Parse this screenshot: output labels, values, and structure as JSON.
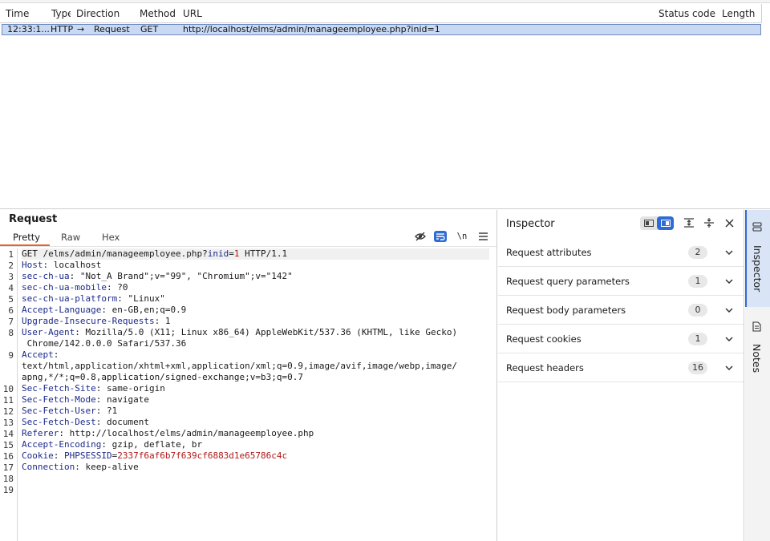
{
  "table": {
    "columns": [
      "Time",
      "Type",
      "Direction",
      "Method",
      "URL",
      "Status code",
      "Length"
    ],
    "row": {
      "time": "12:33:1...",
      "type": "HTTP",
      "direction_arrow": "→",
      "direction": "Request",
      "method": "GET",
      "url": "http://localhost/elms/admin/manageemployee.php?inid=1",
      "status": "",
      "length": ""
    }
  },
  "request": {
    "title": "Request",
    "tabs": [
      "Pretty",
      "Raw",
      "Hex"
    ],
    "active_tab": "Pretty",
    "toolbar_newline": "\\n",
    "line_numbers": [
      "1",
      "2",
      "3",
      "4",
      "5",
      "6",
      "7",
      "8",
      "9",
      "10",
      "11",
      "12",
      "13",
      "14",
      "15",
      "16",
      "17",
      "18",
      "19"
    ],
    "lines": {
      "l1": {
        "method": "GET",
        "path": " /elms/admin/manageemployee.php?",
        "param": "inid",
        "eq": "=",
        "val": "1",
        "proto": " HTTP/1.1"
      },
      "l2": {
        "k": "Host",
        "v": "localhost"
      },
      "l3": {
        "k": "sec-ch-ua",
        "v": "\"Not_A Brand\";v=\"99\", \"Chromium\";v=\"142\""
      },
      "l4": {
        "k": "sec-ch-ua-mobile",
        "v": "?0"
      },
      "l5": {
        "k": "sec-ch-ua-platform",
        "v": "\"Linux\""
      },
      "l6": {
        "k": "Accept-Language",
        "v": "en-GB,en;q=0.9"
      },
      "l7": {
        "k": "Upgrade-Insecure-Requests",
        "v": "1"
      },
      "l8": {
        "k": "User-Agent",
        "v": "Mozilla/5.0 (X11; Linux x86_64) AppleWebKit/537.36 (KHTML, like Gecko)",
        "v2": " Chrome/142.0.0.0 Safari/537.36"
      },
      "l9": {
        "k": "Accept",
        "v": "text/html,application/xhtml+xml,application/xml;q=0.9,image/avif,image/webp,image/",
        "v2": "apng,*/*;q=0.8,application/signed-exchange;v=b3;q=0.7"
      },
      "l10": {
        "k": "Sec-Fetch-Site",
        "v": "same-origin"
      },
      "l11": {
        "k": "Sec-Fetch-Mode",
        "v": "navigate"
      },
      "l12": {
        "k": "Sec-Fetch-User",
        "v": "?1"
      },
      "l13": {
        "k": "Sec-Fetch-Dest",
        "v": "document"
      },
      "l14": {
        "k": "Referer",
        "v": "http://localhost/elms/admin/manageemployee.php"
      },
      "l15": {
        "k": "Accept-Encoding",
        "v": "gzip, deflate, br"
      },
      "l16": {
        "k": "Cookie",
        "cname": "PHPSESSID",
        "eq": "=",
        "cval": "2337f6af6b7f639cf6883d1e65786c4c"
      },
      "l17": {
        "k": "Connection",
        "v": "keep-alive"
      }
    }
  },
  "inspector": {
    "title": "Inspector",
    "sections": [
      {
        "label": "Request attributes",
        "count": "2"
      },
      {
        "label": "Request query parameters",
        "count": "1"
      },
      {
        "label": "Request body parameters",
        "count": "0"
      },
      {
        "label": "Request cookies",
        "count": "1"
      },
      {
        "label": "Request headers",
        "count": "16"
      }
    ]
  },
  "rail": {
    "inspector": "Inspector",
    "notes": "Notes"
  },
  "colors": {
    "accent": "#e8622a",
    "selection": "#c9d9f3",
    "active_blue": "#2f6bd6",
    "header_key": "#1d2a8a",
    "cookie_value": "#b01717"
  }
}
